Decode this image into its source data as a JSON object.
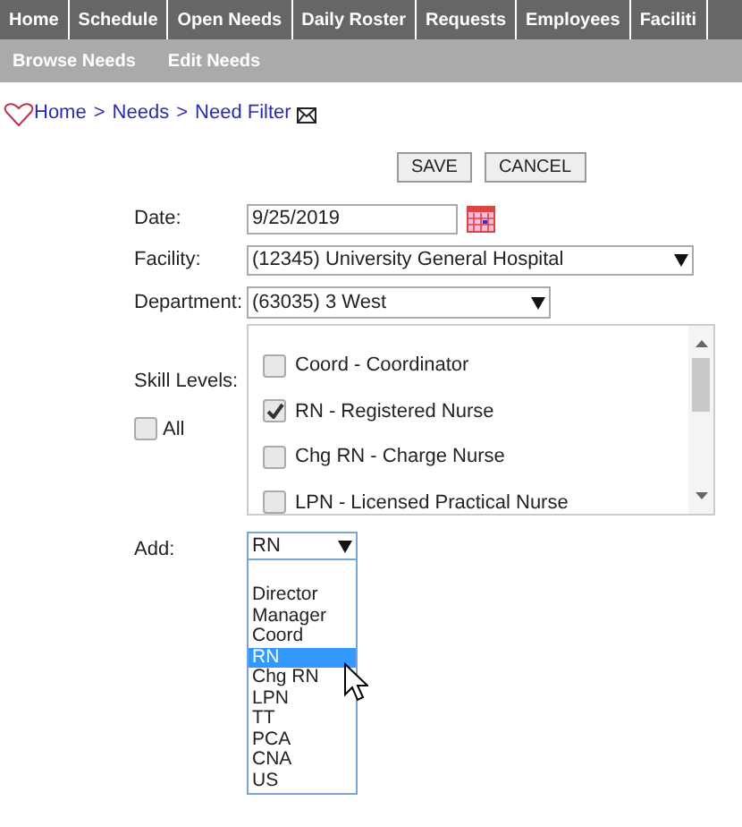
{
  "nav": [
    {
      "label": "Home",
      "selected": false
    },
    {
      "label": "Schedule",
      "selected": false
    },
    {
      "label": "Open Needs",
      "selected": false
    },
    {
      "label": "Daily Roster",
      "selected": false
    },
    {
      "label": "Requests",
      "selected": false
    },
    {
      "label": "Employees",
      "selected": false
    },
    {
      "label": "Faciliti",
      "selected": false
    }
  ],
  "subnav": [
    "Browse Needs",
    "Edit Needs"
  ],
  "breadcrumb": [
    "Home",
    "Needs",
    "Need Filter"
  ],
  "breadcrumb_separator": ">",
  "buttons": [
    "SAVE",
    "CANCEL"
  ],
  "form": {
    "date": {
      "label": "Date:",
      "value": "9/25/2019"
    },
    "facility": {
      "label": "Facility:",
      "value": "(12345) University General Hospital"
    },
    "department": {
      "label": "Department:",
      "value": "(63035) 3 West"
    },
    "skill_levels": {
      "label": "Skill Levels:",
      "all": {
        "label": "All",
        "checked": false
      },
      "items": [
        {
          "label": "Coord - Coordinator",
          "checked": false
        },
        {
          "label": "RN - Registered Nurse",
          "checked": true
        },
        {
          "label": "Chg RN - Charge Nurse",
          "checked": false
        },
        {
          "label": "LPN - Licensed Practical Nurse",
          "checked": false
        }
      ]
    },
    "add": {
      "label": "Add:",
      "value": "RN",
      "options": [
        {
          "label": "Director",
          "selected": false
        },
        {
          "label": "Manager",
          "selected": false
        },
        {
          "label": "Coord",
          "selected": false
        },
        {
          "label": "RN",
          "selected": true
        },
        {
          "label": "Chg RN",
          "selected": false
        },
        {
          "label": "LPN",
          "selected": false
        },
        {
          "label": "TT",
          "selected": false
        },
        {
          "label": "PCA",
          "selected": false
        },
        {
          "label": "CNA",
          "selected": false
        },
        {
          "label": "US",
          "selected": false
        }
      ]
    }
  }
}
